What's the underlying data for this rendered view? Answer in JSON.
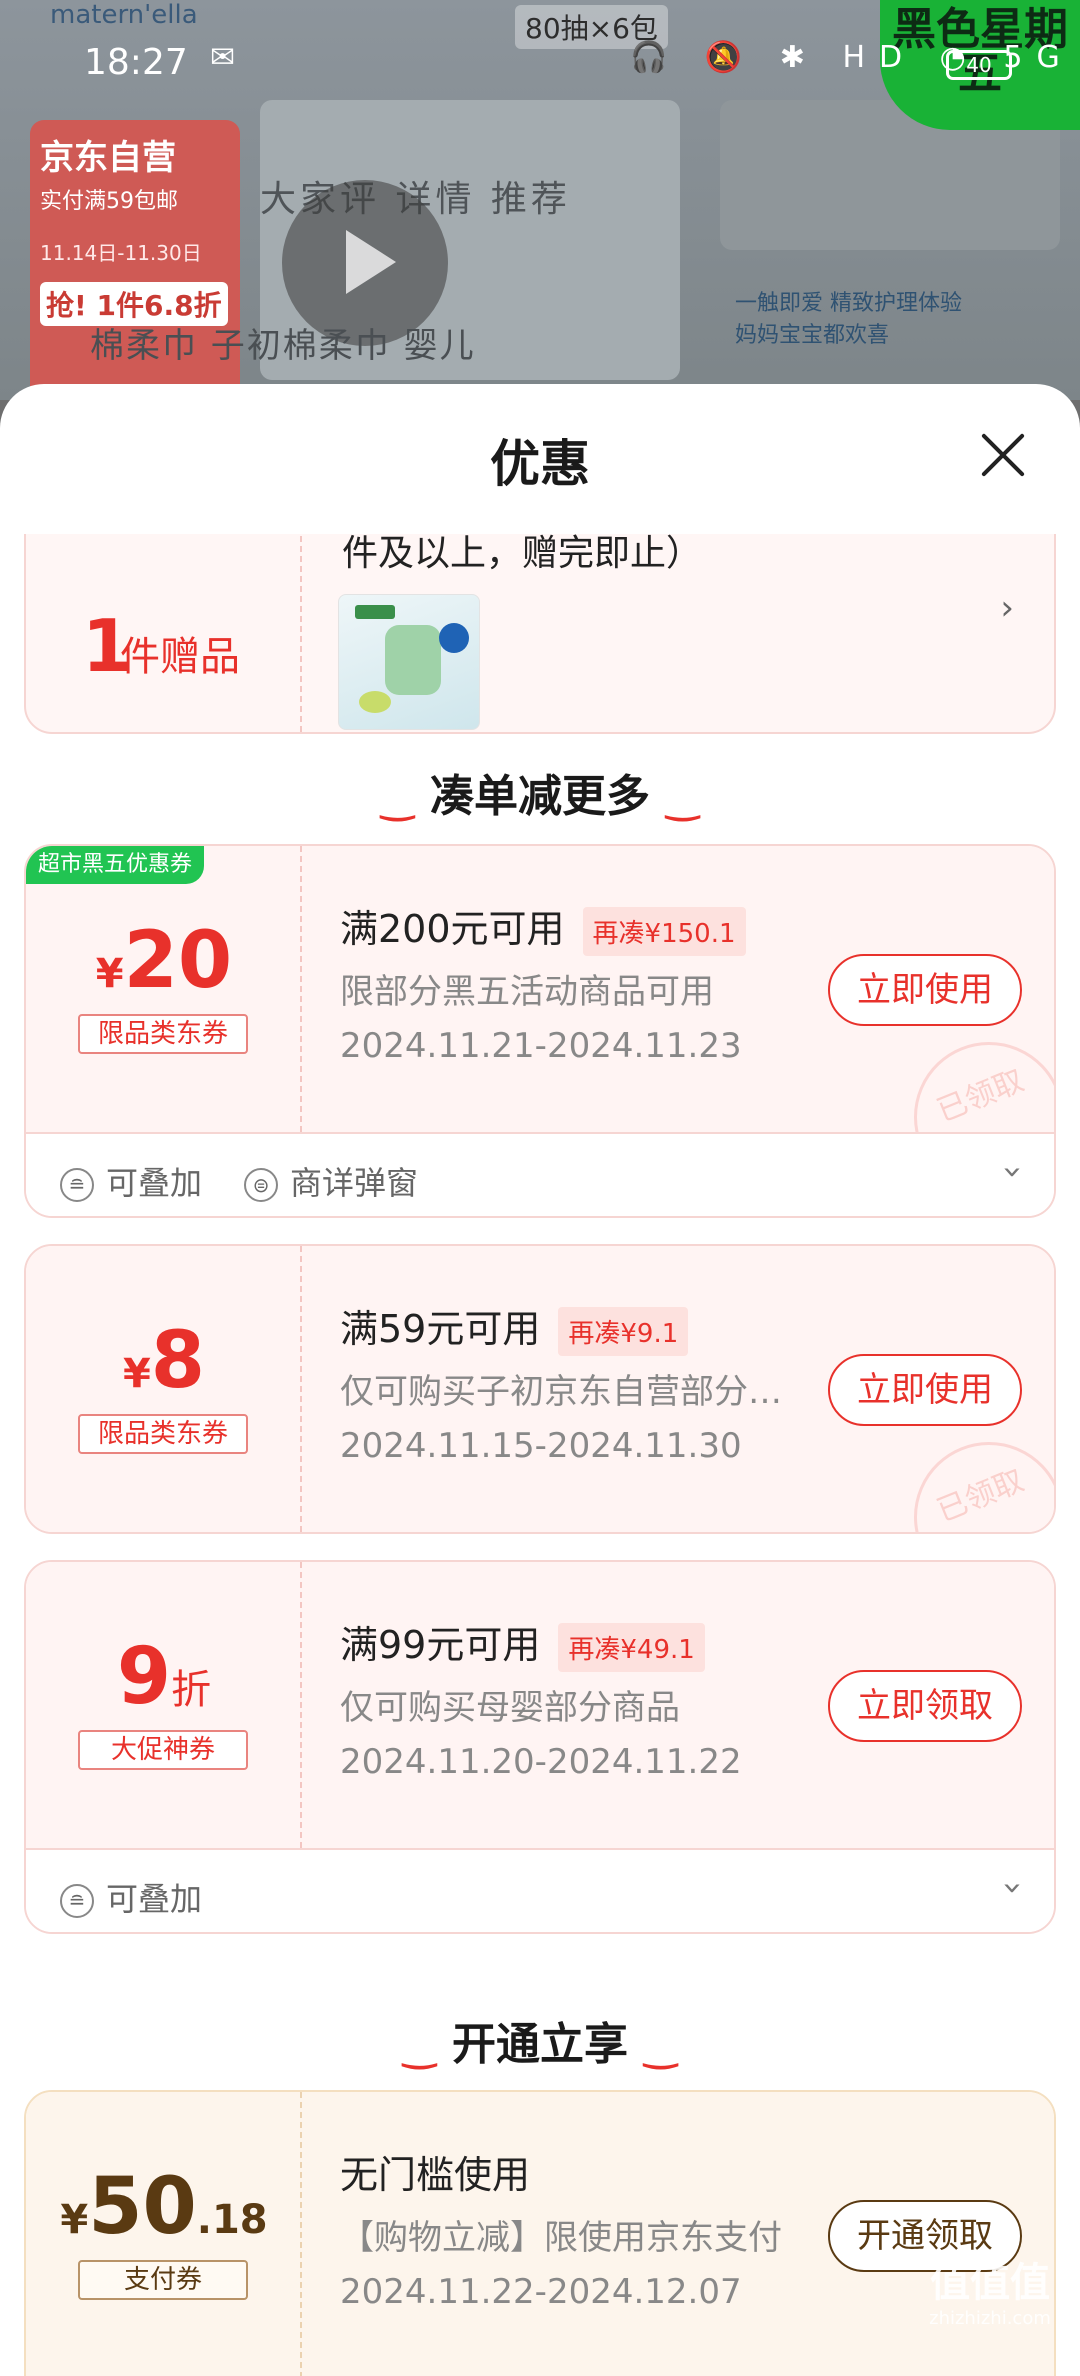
{
  "background": {
    "brand": "matern'ella",
    "pack_label": "80抽×6包",
    "jd_title": "京东自营",
    "jd_sub": "实付满59包邮",
    "jd_dates": "11.14日-11.30日",
    "jd_deal": "抢! 1件6.8折",
    "tabs": "大家评 详情 推荐",
    "right_text_1": "一触即爱 精致护理体验",
    "right_text_2": "妈妈宝宝都欢喜",
    "tags": "棉柔巾   子初棉柔巾   婴儿",
    "badge": "黑色星期五"
  },
  "status_bar": {
    "time": "18:27",
    "battery": "40",
    "icons": "🎧 🔕 ✱ HD ◔ 5G"
  },
  "sheet": {
    "title": "优惠",
    "gift": {
      "count": "1",
      "unit": "件赠品",
      "desc": "件及以上，赠完即止）"
    },
    "section_more": "凑单减更多",
    "section_open": "开通立享",
    "coupons": [
      {
        "ribbon": "超市黑五优惠券",
        "currency": "¥",
        "amount": "20",
        "tag": "限品类东券",
        "condition": "满200元可用",
        "need": "再凑¥150.1",
        "desc": "限部分黑五活动商品可用",
        "date": "2024.11.21-2024.11.23",
        "button": "立即使用",
        "stamp": "已领取",
        "features": [
          "可叠加",
          "商详弹窗"
        ]
      },
      {
        "currency": "¥",
        "amount": "8",
        "tag": "限品类东券",
        "condition": "满59元可用",
        "need": "再凑¥9.1",
        "desc": "仅可购买子初京东自营部分商品",
        "date": "2024.11.15-2024.11.30",
        "button": "立即使用",
        "stamp": "已领取"
      },
      {
        "amount": "9",
        "suffix": "折",
        "tag": "大促神券",
        "condition": "满99元可用",
        "need": "再凑¥49.1",
        "desc": "仅可购买母婴部分商品",
        "date": "2024.11.20-2024.11.22",
        "button": "立即领取",
        "features": [
          "可叠加"
        ]
      },
      {
        "currency": "¥",
        "amount": "50",
        "decimal": ".18",
        "tag": "支付券",
        "condition": "无门槛使用",
        "desc": "【购物立减】限使用京东支付",
        "date": "2024.11.22-2024.12.07",
        "button": "开通领取"
      }
    ]
  },
  "watermark": {
    "main": "值值值",
    "sub": "zhizhizhi.com"
  }
}
